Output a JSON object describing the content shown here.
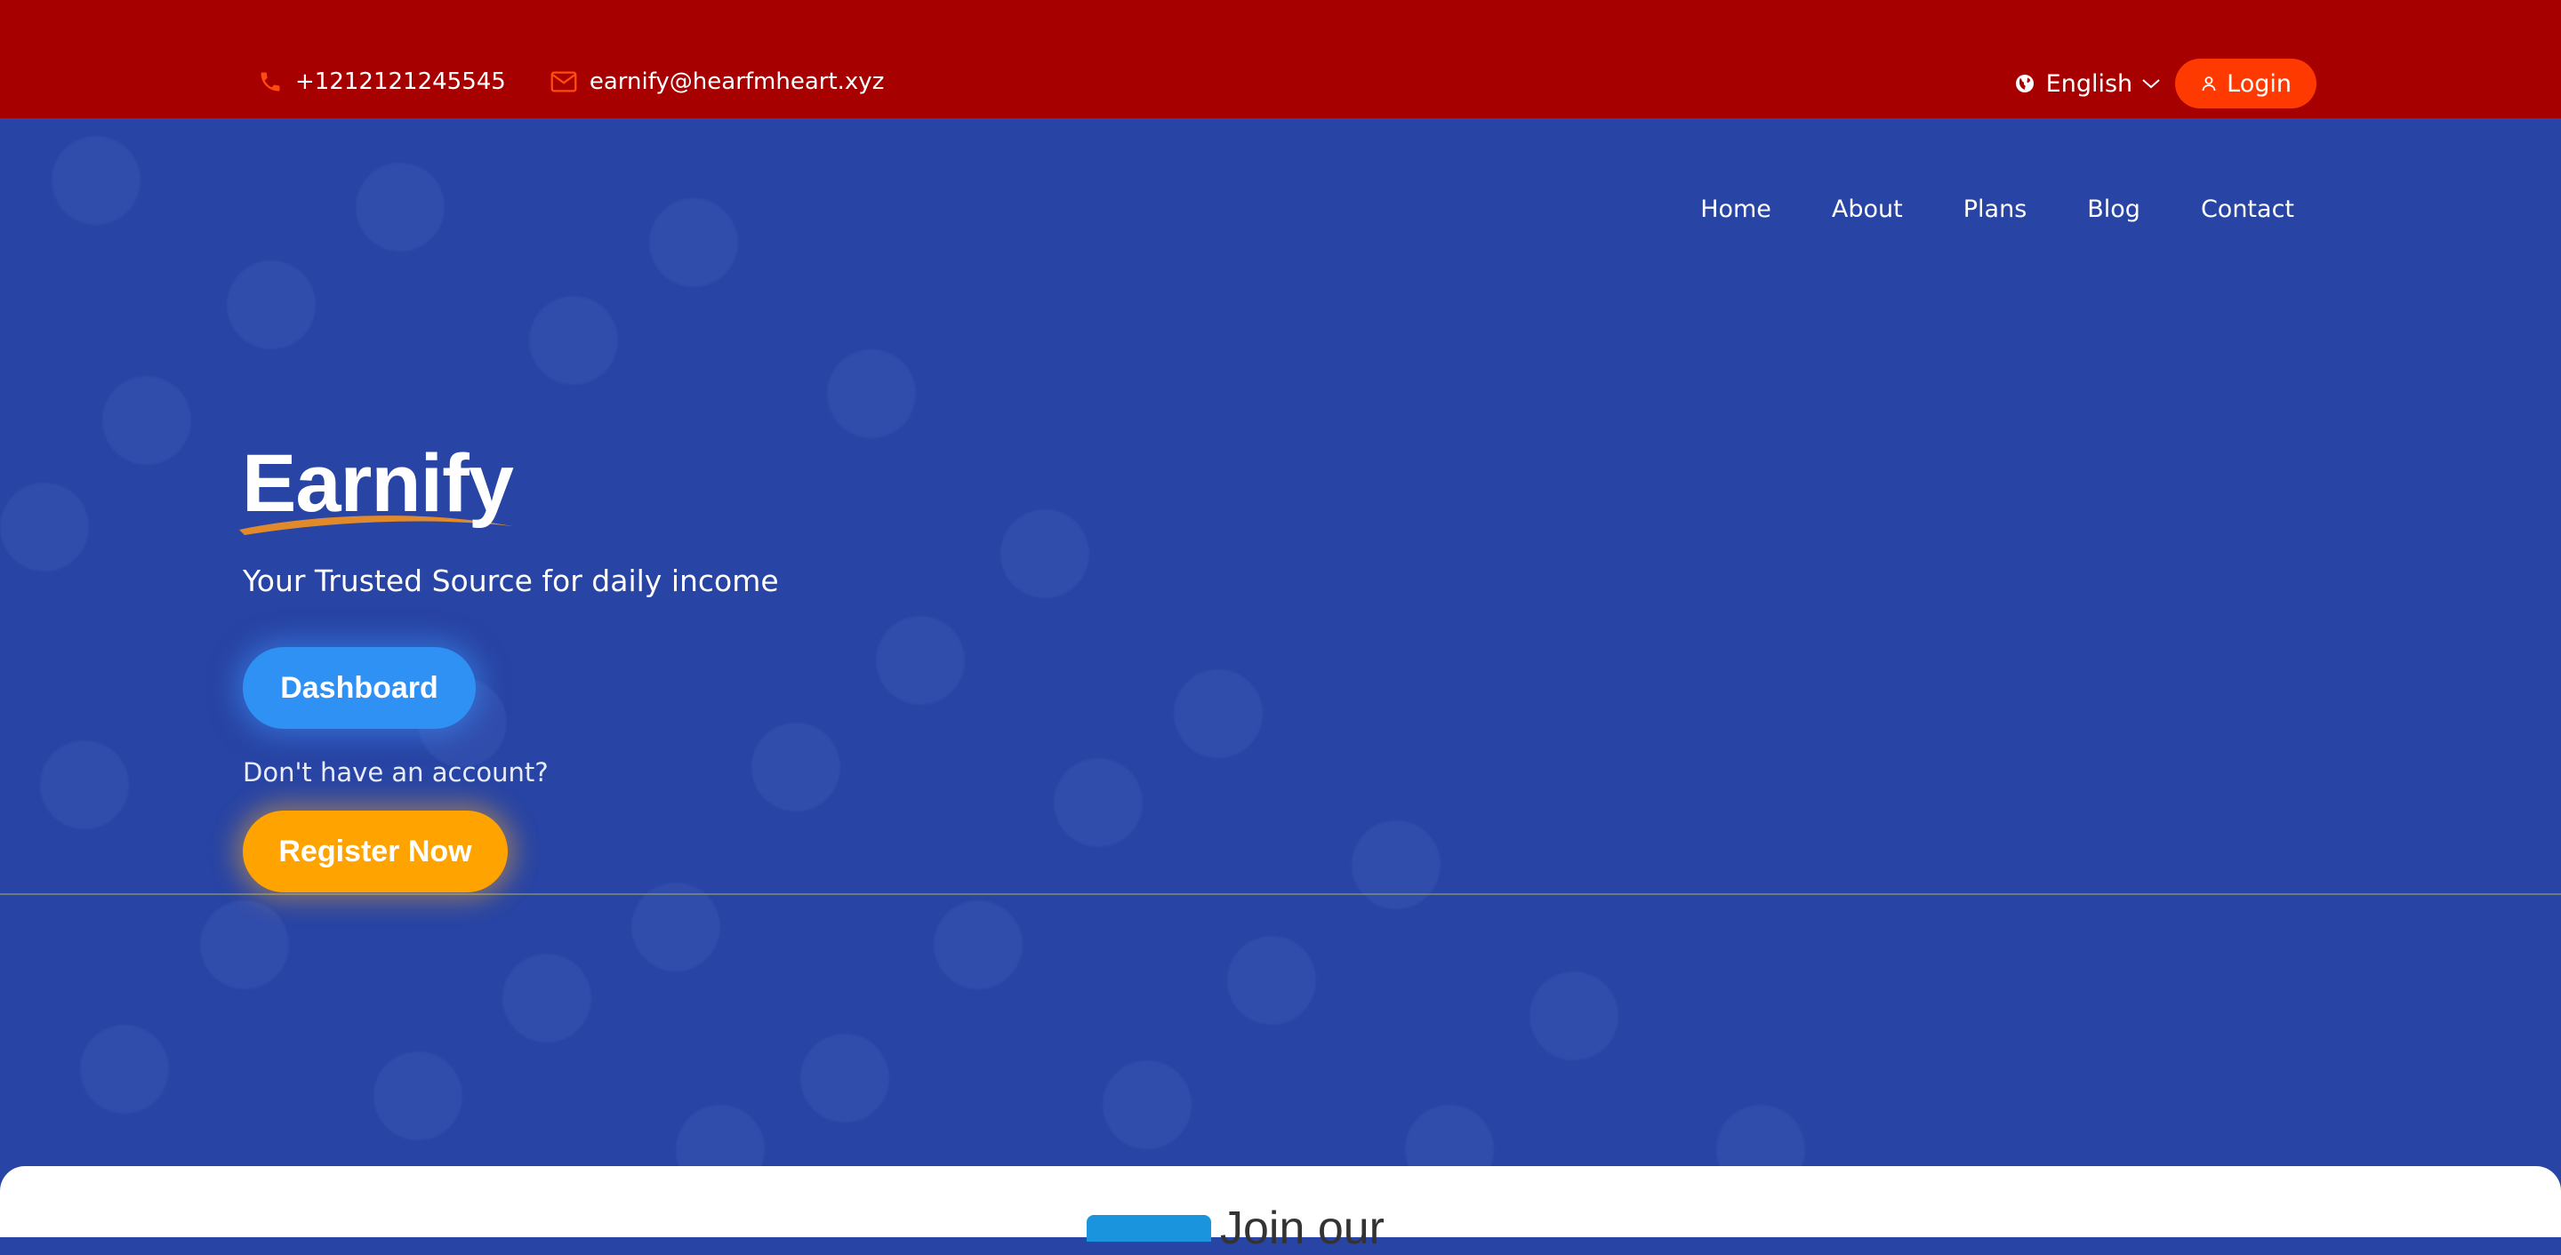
{
  "topbar": {
    "phone": "+1212121245545",
    "email": "earnify@hearfmheart.xyz",
    "language": "English",
    "login_label": "Login",
    "colors": {
      "bar": "#a60000",
      "accent": "#ff3a00"
    }
  },
  "nav": {
    "items": [
      "Home",
      "About",
      "Plans",
      "Blog",
      "Contact"
    ]
  },
  "hero": {
    "brand": "Earnify",
    "tagline": "Your Trusted Source for daily income",
    "dashboard_label": "Dashboard",
    "no_account": "Don't have an account?",
    "register_label": "Register Now",
    "colors": {
      "background": "#2844a4",
      "dashboard": "#2f91f3",
      "register": "#ffa300"
    }
  },
  "bottom": {
    "heading_partial": "Join our"
  },
  "icons": {
    "phone": "phone-icon",
    "email": "mail-icon",
    "globe": "globe-icon",
    "chevron": "chevron-down-icon",
    "user": "user-icon"
  }
}
